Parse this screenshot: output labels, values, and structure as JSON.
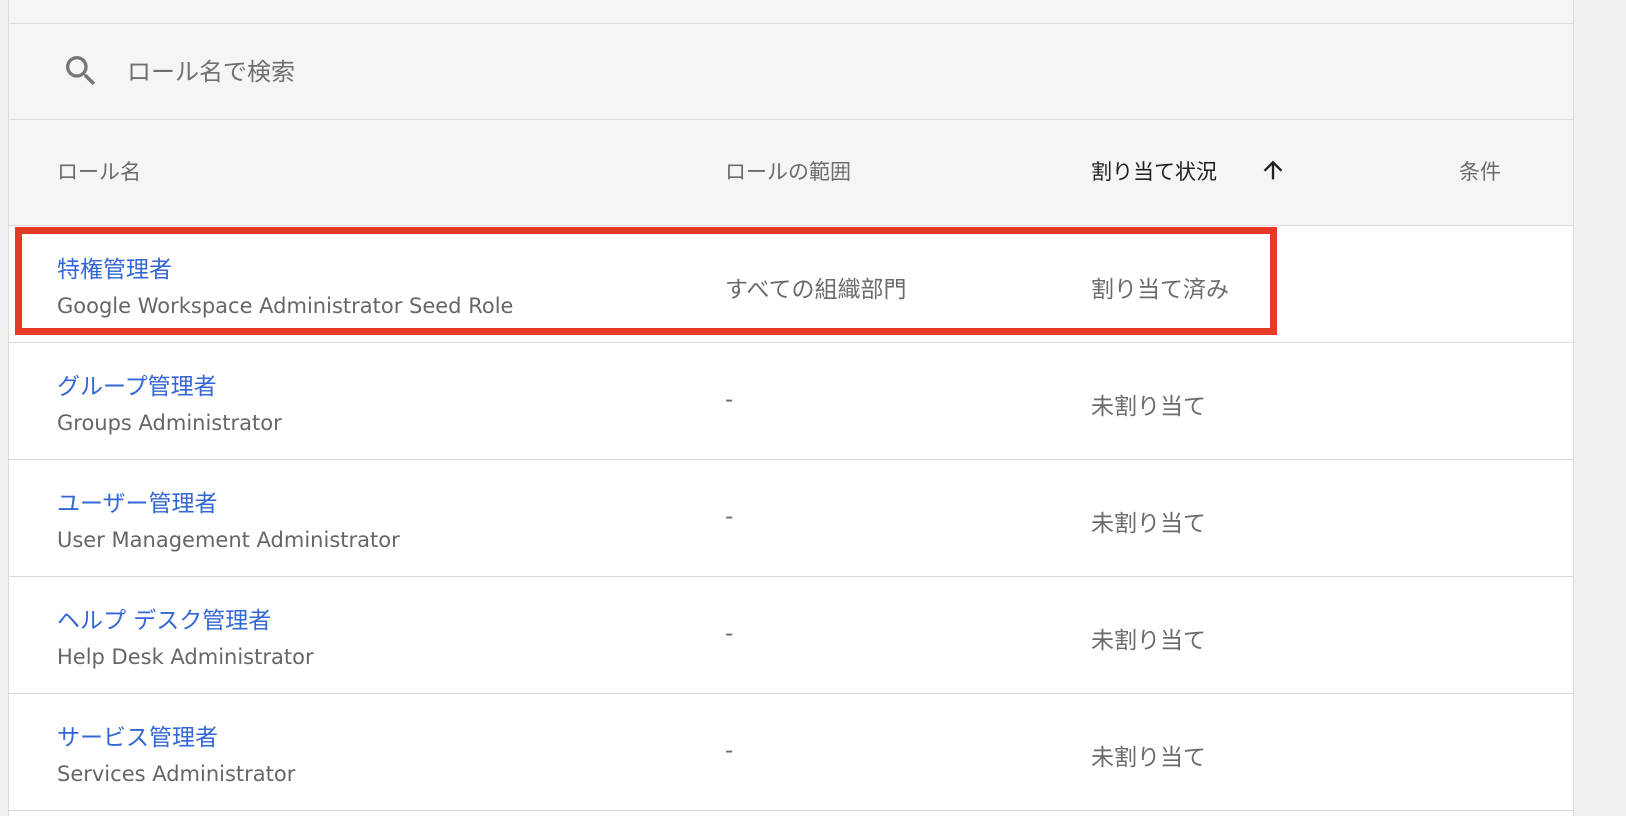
{
  "search": {
    "placeholder": "ロール名で検索",
    "value": ""
  },
  "columns": {
    "role_name": "ロール名",
    "role_scope": "ロールの範囲",
    "assignment_status": "割り当て状況",
    "conditions": "条件"
  },
  "sort": {
    "column": "assignment_status",
    "direction": "ascending",
    "icon": "arrow-up-icon"
  },
  "rows": [
    {
      "name": "特権管理者",
      "subtitle": "Google Workspace Administrator Seed Role",
      "scope": "すべての組織部門",
      "status": "割り当て済み",
      "conditions": ""
    },
    {
      "name": "グループ管理者",
      "subtitle": "Groups Administrator",
      "scope": "-",
      "status": "未割り当て",
      "conditions": ""
    },
    {
      "name": "ユーザー管理者",
      "subtitle": "User Management Administrator",
      "scope": "-",
      "status": "未割り当て",
      "conditions": ""
    },
    {
      "name": "ヘルプ デスク管理者",
      "subtitle": "Help Desk Administrator",
      "scope": "-",
      "status": "未割り当て",
      "conditions": ""
    },
    {
      "name": "サービス管理者",
      "subtitle": "Services Administrator",
      "scope": "-",
      "status": "未割り当て",
      "conditions": ""
    }
  ],
  "highlight": {
    "color": "#e53b26",
    "row_index": 0
  },
  "colors": {
    "link": "#3367d6",
    "text_secondary": "#6b6b6b",
    "header_bg": "#f5f5f5"
  }
}
